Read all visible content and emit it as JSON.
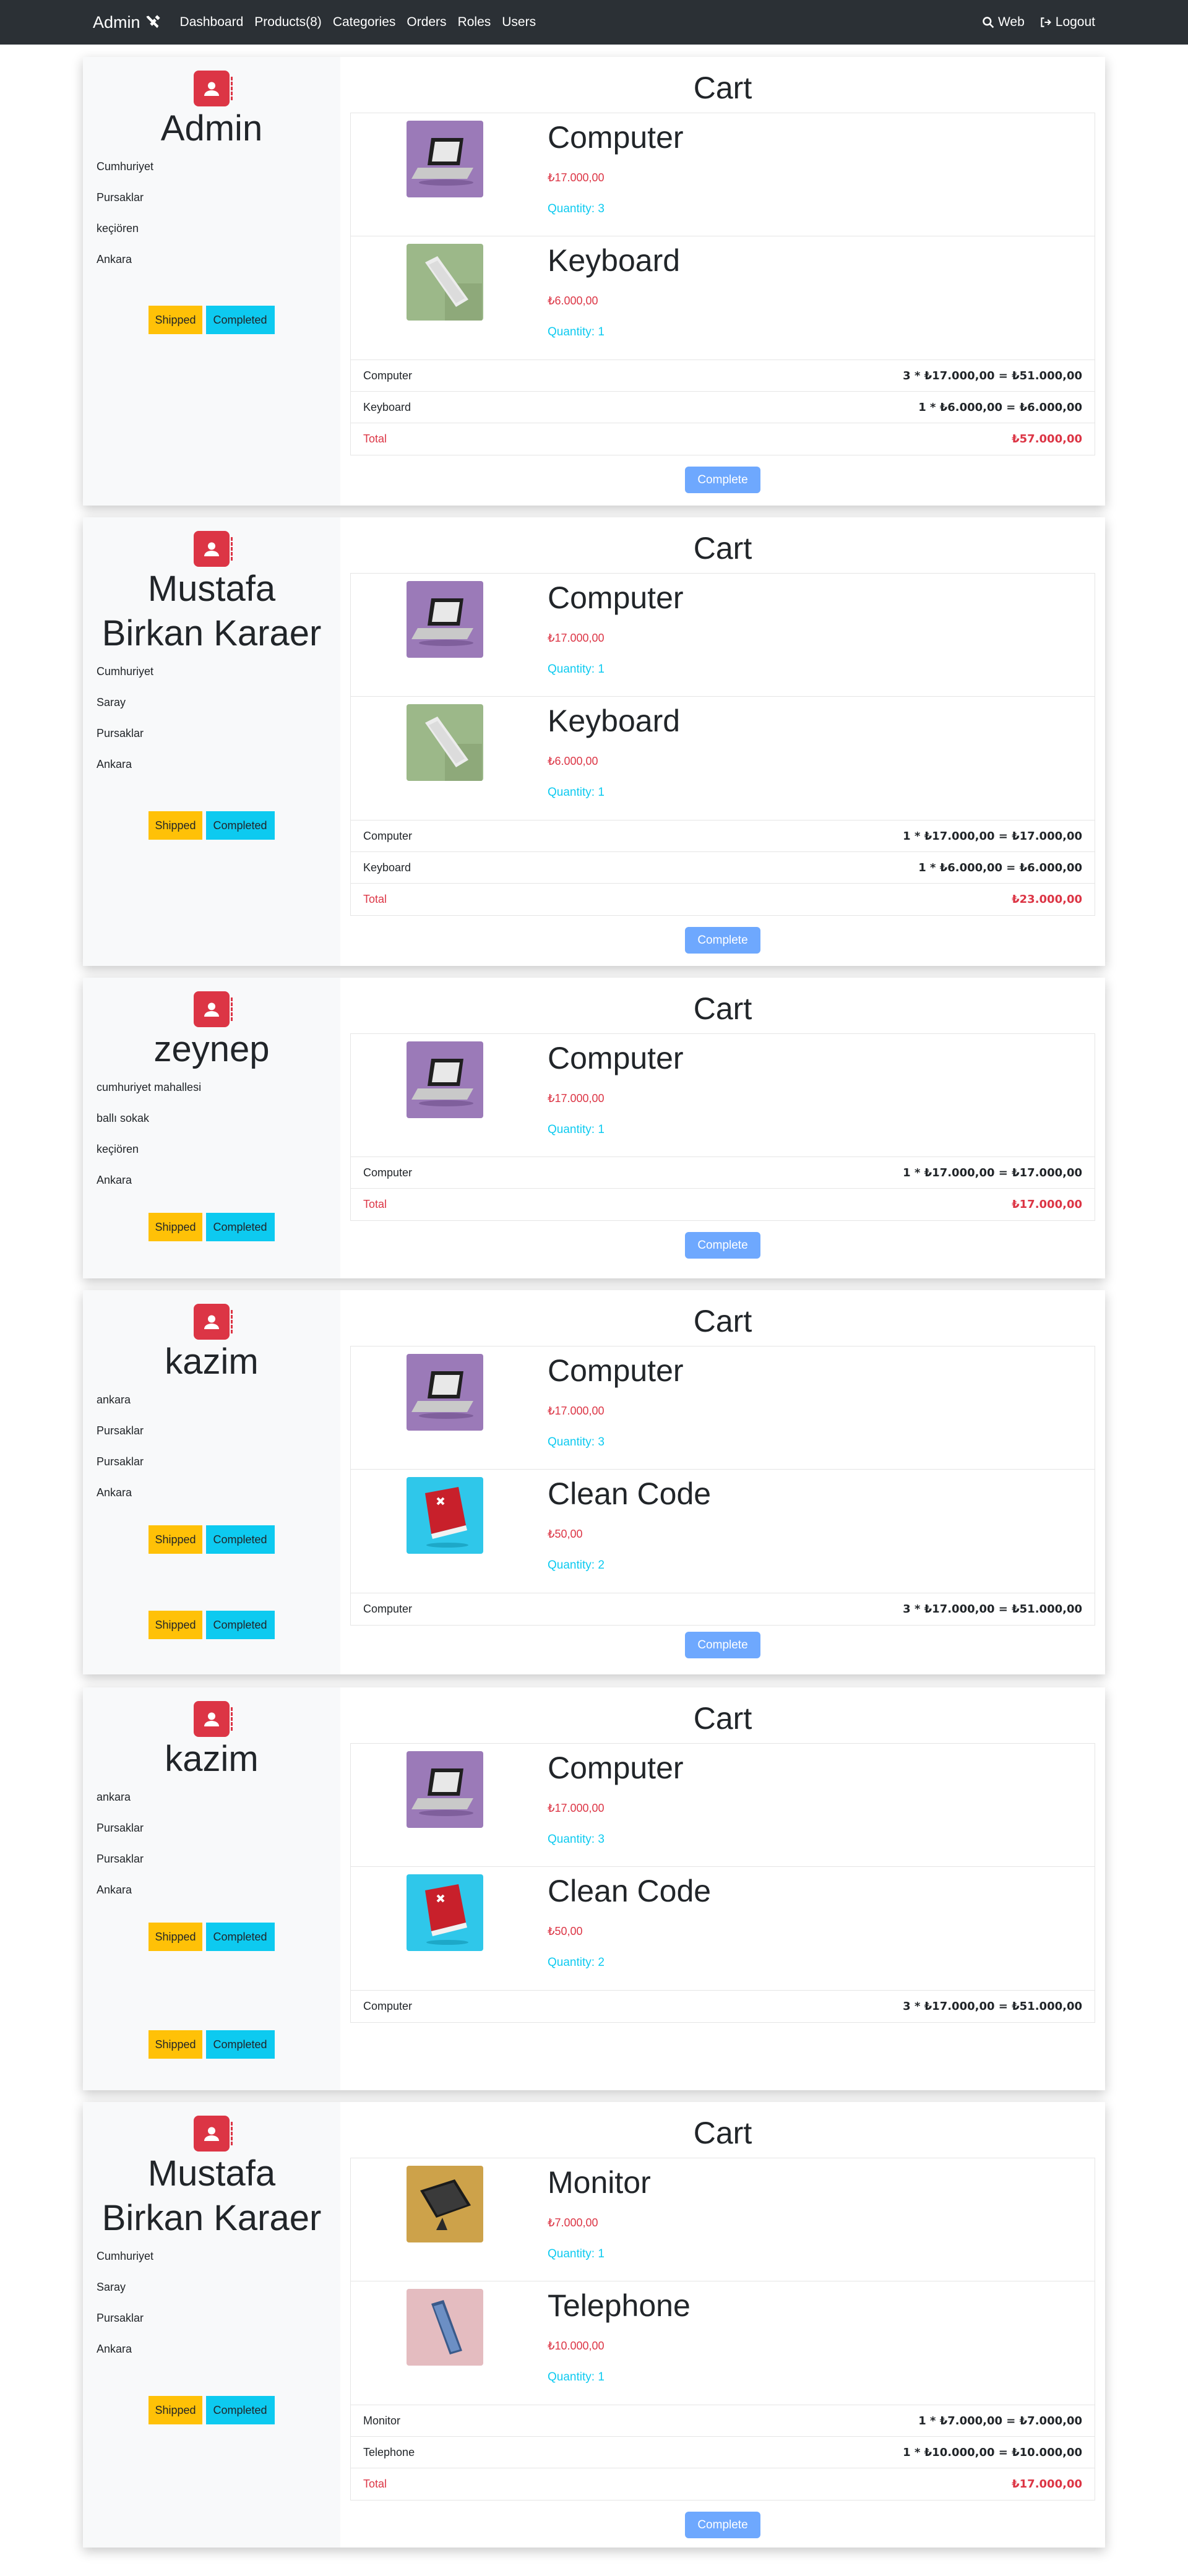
{
  "nav": {
    "brand": "Admin",
    "links": [
      "Dashboard",
      "Products(8)",
      "Categories",
      "Orders",
      "Roles",
      "Users"
    ],
    "web": "Web",
    "logout": "Logout"
  },
  "labels": {
    "cart_title": "Cart",
    "shipped": "Shipped",
    "completed": "Completed",
    "complete": "Complete",
    "total": "Total"
  },
  "orders": [
    {
      "name": "Admin",
      "address": [
        "Cumhuriyet",
        "Pursaklar",
        "keçiören",
        "Ankara"
      ],
      "products": [
        {
          "name": "Computer",
          "price": "₺17.000,00",
          "qty": "Quantity: 3",
          "image": "laptop"
        },
        {
          "name": "Keyboard",
          "price": "₺6.000,00",
          "qty": "Quantity: 1",
          "image": "keyboard"
        }
      ],
      "lines": [
        {
          "label": "Computer",
          "calc": "3 * ₺17.000,00 = ₺51.000,00"
        },
        {
          "label": "Keyboard",
          "calc": "1 * ₺6.000,00 = ₺6.000,00"
        }
      ],
      "total": "₺57.000,00"
    },
    {
      "name": "Mustafa Birkan Karaer",
      "address": [
        "Cumhuriyet",
        "Saray",
        "Pursaklar",
        "Ankara"
      ],
      "products": [
        {
          "name": "Computer",
          "price": "₺17.000,00",
          "qty": "Quantity: 1",
          "image": "laptop"
        },
        {
          "name": "Keyboard",
          "price": "₺6.000,00",
          "qty": "Quantity: 1",
          "image": "keyboard"
        }
      ],
      "lines": [
        {
          "label": "Computer",
          "calc": "1 * ₺17.000,00 = ₺17.000,00"
        },
        {
          "label": "Keyboard",
          "calc": "1 * ₺6.000,00 = ₺6.000,00"
        }
      ],
      "total": "₺23.000,00"
    },
    {
      "name": "zeynep",
      "address": [
        "cumhuriyet mahallesi",
        "ballı sokak",
        "keçiören",
        "Ankara"
      ],
      "products": [
        {
          "name": "Computer",
          "price": "₺17.000,00",
          "qty": "Quantity: 1",
          "image": "laptop"
        }
      ],
      "lines": [
        {
          "label": "Computer",
          "calc": "1 * ₺17.000,00 = ₺17.000,00"
        }
      ],
      "total": "₺17.000,00"
    },
    {
      "name": "kazim",
      "address": [
        "ankara",
        "Pursaklar",
        "Pursaklar",
        "Ankara"
      ],
      "products": [
        {
          "name": "Computer",
          "price": "₺17.000,00",
          "qty": "Quantity: 3",
          "image": "laptop"
        },
        {
          "name": "Clean Code",
          "price": "₺50,00",
          "qty": "Quantity: 2",
          "image": "book"
        }
      ],
      "lines": [
        {
          "label": "Computer",
          "calc": "3 * ₺17.000,00 = ₺51.000,00"
        }
      ],
      "total": "",
      "button_sets": 2,
      "show_complete": true
    },
    {
      "name": "kazim",
      "address": [
        "ankara",
        "Pursaklar",
        "Pursaklar",
        "Ankara"
      ],
      "products": [
        {
          "name": "Computer",
          "price": "₺17.000,00",
          "qty": "Quantity: 3",
          "image": "laptop"
        },
        {
          "name": "Clean Code",
          "price": "₺50,00",
          "qty": "Quantity: 2",
          "image": "book"
        }
      ],
      "lines": [
        {
          "label": "Computer",
          "calc": "3 * ₺17.000,00 = ₺51.000,00"
        }
      ],
      "total": "",
      "button_sets": 2,
      "show_complete": false
    },
    {
      "name": "Mustafa Birkan Karaer",
      "address": [
        "Cumhuriyet",
        "Saray",
        "Pursaklar",
        "Ankara"
      ],
      "products": [
        {
          "name": "Monitor",
          "price": "₺7.000,00",
          "qty": "Quantity: 1",
          "image": "monitor"
        },
        {
          "name": "Telephone",
          "price": "₺10.000,00",
          "qty": "Quantity: 1",
          "image": "phone"
        }
      ],
      "lines": [
        {
          "label": "Monitor",
          "calc": "1 * ₺7.000,00 = ₺7.000,00"
        },
        {
          "label": "Telephone",
          "calc": "1 * ₺10.000,00 = ₺10.000,00"
        }
      ],
      "total": "₺17.000,00"
    }
  ]
}
